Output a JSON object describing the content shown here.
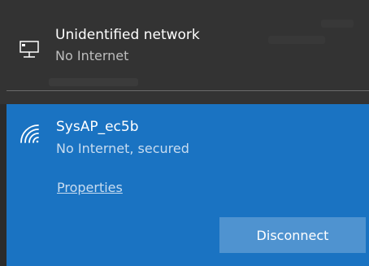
{
  "networks": {
    "wired": {
      "name": "Unidentified network",
      "status": "No Internet",
      "icon": "ethernet-monitor-icon"
    },
    "wifi": {
      "name": "SysAP_ec5b",
      "status": "No Internet, secured",
      "icon": "wifi-signal-icon",
      "properties_label": "Properties",
      "disconnect_label": "Disconnect"
    }
  },
  "colors": {
    "wired_background": "#333333",
    "selected_background": "#1a73c2",
    "button_background": "#4f93d0"
  }
}
